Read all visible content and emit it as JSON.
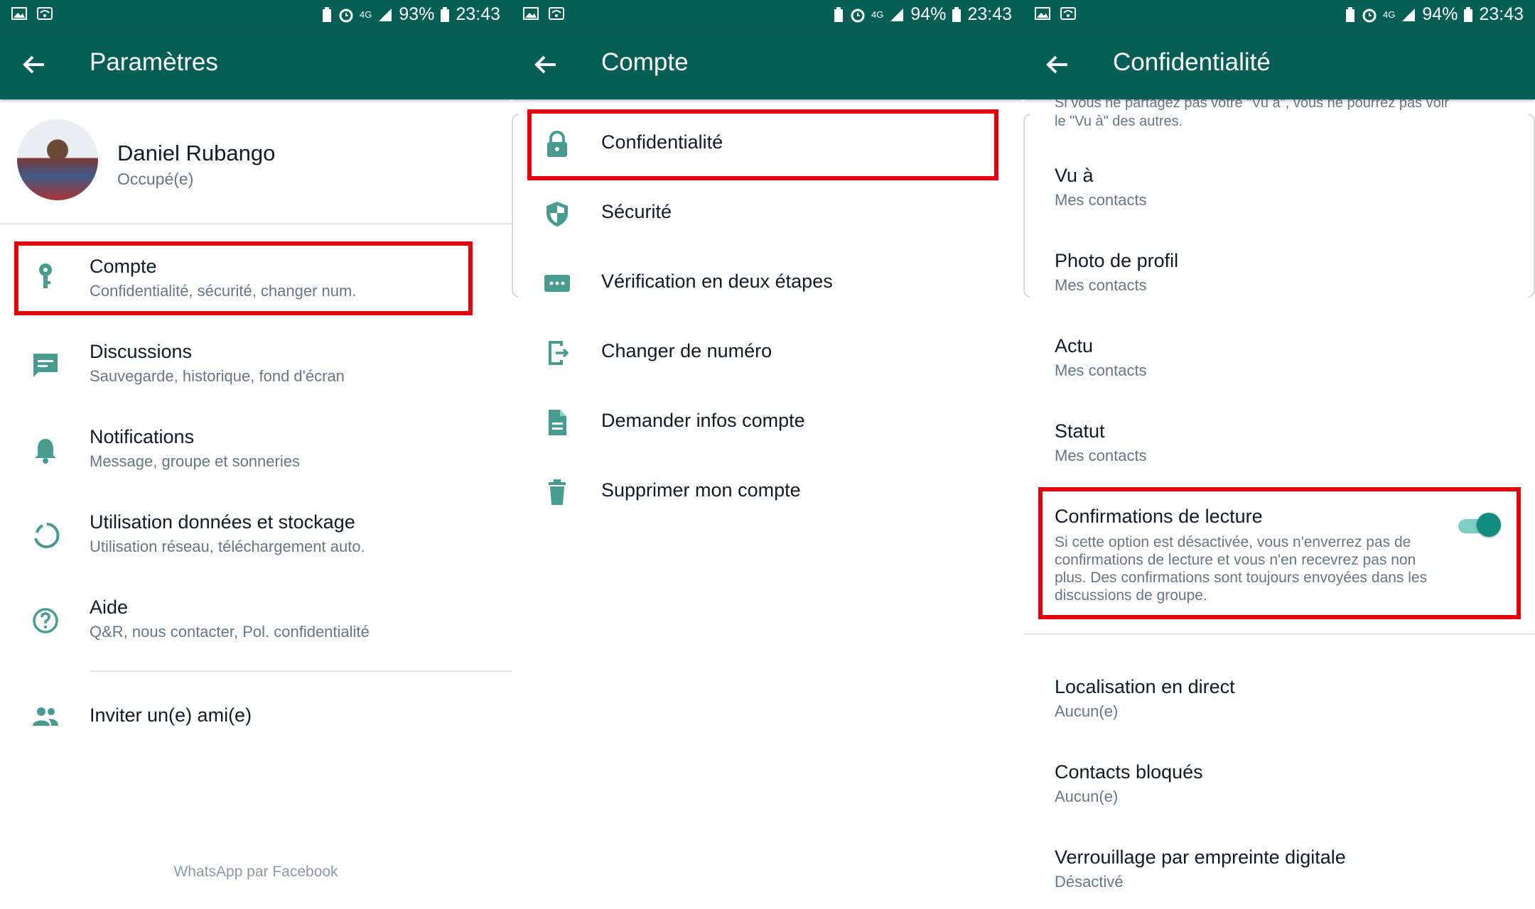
{
  "panels": [
    {
      "status": {
        "battery": "93%",
        "time": "23:43",
        "network": "4G"
      },
      "title": "Paramètres",
      "profile": {
        "name": "Daniel Rubango",
        "status": "Occupé(e)"
      },
      "items": [
        {
          "icon": "key-icon",
          "label": "Compte",
          "sub": "Confidentialité, sécurité, changer num."
        },
        {
          "icon": "chat-icon",
          "label": "Discussions",
          "sub": "Sauvegarde, historique, fond d'écran"
        },
        {
          "icon": "bell-icon",
          "label": "Notifications",
          "sub": "Message, groupe et sonneries"
        },
        {
          "icon": "data-usage-icon",
          "label": "Utilisation données et stockage",
          "sub": "Utilisation réseau, téléchargement auto."
        },
        {
          "icon": "help-icon",
          "label": "Aide",
          "sub": "Q&R, nous contacter, Pol. confidentialité"
        }
      ],
      "invite": {
        "icon": "people-icon",
        "label": "Inviter un(e) ami(e)"
      },
      "footer": "WhatsApp par Facebook"
    },
    {
      "status": {
        "battery": "94%",
        "time": "23:43",
        "network": "4G"
      },
      "title": "Compte",
      "items": [
        {
          "icon": "lock-icon",
          "label": "Confidentialité"
        },
        {
          "icon": "shield-icon",
          "label": "Sécurité"
        },
        {
          "icon": "dots-icon",
          "label": "Vérification en deux étapes"
        },
        {
          "icon": "phone-change-icon",
          "label": "Changer de numéro"
        },
        {
          "icon": "document-icon",
          "label": "Demander infos compte"
        },
        {
          "icon": "trash-icon",
          "label": "Supprimer mon compte"
        }
      ]
    },
    {
      "status": {
        "battery": "94%",
        "time": "23:43",
        "network": "4G"
      },
      "title": "Confidentialité",
      "top_note": "Si vous ne partagez pas votre \"Vu à\", vous ne pourrez pas voir le \"Vu à\" des autres.",
      "items": [
        {
          "label": "Vu à",
          "sub": "Mes contacts"
        },
        {
          "label": "Photo de profil",
          "sub": "Mes contacts"
        },
        {
          "label": "Actu",
          "sub": "Mes contacts"
        },
        {
          "label": "Statut",
          "sub": "Mes contacts"
        }
      ],
      "read_receipts": {
        "label": "Confirmations de lecture",
        "desc": "Si cette option est désactivée, vous n'enverrez pas de confirmations de lecture et vous n'en recevrez pas non plus. Des confirmations sont toujours envoyées dans les discussions de groupe.",
        "enabled": true
      },
      "items2": [
        {
          "label": "Localisation en direct",
          "sub": "Aucun(e)"
        },
        {
          "label": "Contacts bloqués",
          "sub": "Aucun(e)"
        },
        {
          "label": "Verrouillage par empreinte digitale",
          "sub": "Désactivé"
        }
      ]
    }
  ],
  "colors": {
    "header": "#075e54",
    "accent": "#128c7e",
    "icon": "#4a9b8f",
    "highlight": "#e3000f"
  }
}
